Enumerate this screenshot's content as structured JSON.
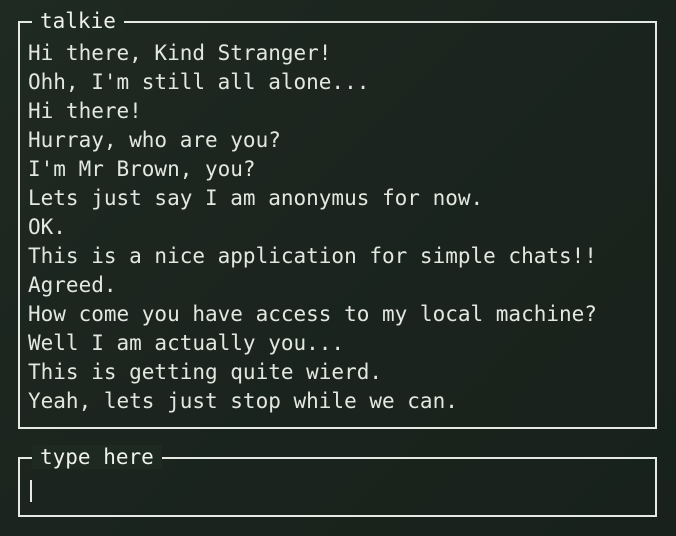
{
  "chat": {
    "title": "talkie",
    "messages": [
      "Hi there, Kind Stranger!",
      "Ohh, I'm still all alone...",
      "Hi there!",
      "Hurray, who are you?",
      "I'm Mr Brown, you?",
      "Lets just say I am anonymus for now.",
      "OK.",
      "This is a nice application for simple chats!!",
      "Agreed.",
      "How come you have access to my local machine?",
      "Well I am actually you...",
      "This is getting quite wierd.",
      "Yeah, lets just stop while we can."
    ]
  },
  "input": {
    "title": "type here",
    "value": ""
  },
  "colors": {
    "background": "#1e2921",
    "border": "#e6e9e3",
    "text": "#e3e7e1"
  }
}
